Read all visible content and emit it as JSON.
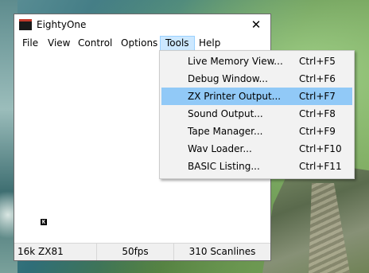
{
  "window": {
    "title": "EightyOne",
    "close_glyph": "✕",
    "app_icon": "eightyone-app-icon"
  },
  "menubar": {
    "items": [
      {
        "label": "File"
      },
      {
        "label": "View"
      },
      {
        "label": "Control"
      },
      {
        "label": "Options"
      },
      {
        "label": "Tools",
        "active": true
      },
      {
        "label": "Help"
      }
    ]
  },
  "display": {
    "cursor_char": "K"
  },
  "statusbar": {
    "machine": "16k ZX81",
    "fps": "50fps",
    "scanlines": "310 Scanlines"
  },
  "tools_menu": {
    "items": [
      {
        "label": "Live Memory View...",
        "shortcut": "Ctrl+F5"
      },
      {
        "label": "Debug Window...",
        "shortcut": "Ctrl+F6"
      },
      {
        "label": "ZX Printer Output...",
        "shortcut": "Ctrl+F7",
        "highlighted": true
      },
      {
        "label": "Sound Output...",
        "shortcut": "Ctrl+F8"
      },
      {
        "label": "Tape Manager...",
        "shortcut": "Ctrl+F9"
      },
      {
        "label": "Wav Loader...",
        "shortcut": "Ctrl+F10"
      },
      {
        "label": "BASIC Listing...",
        "shortcut": "Ctrl+F11"
      }
    ]
  },
  "colors": {
    "menu_active_bg": "#cce8ff",
    "menu_highlight_bg": "#91c9f7",
    "dropdown_bg": "#f2f2f2",
    "statusbar_bg": "#f0f0f0"
  }
}
